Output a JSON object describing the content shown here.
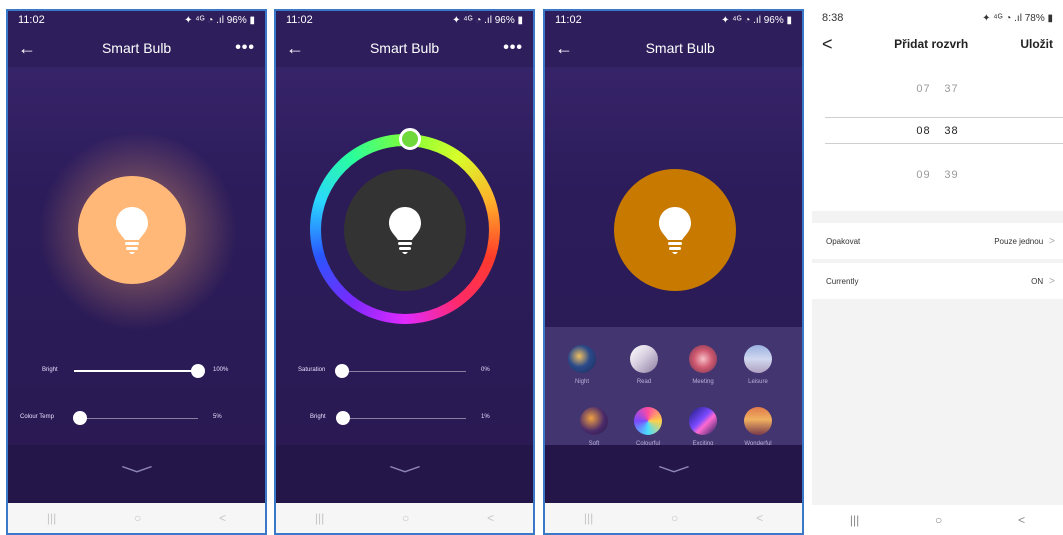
{
  "screen1": {
    "status_time": "11:02",
    "status_right": "✦ ⁴ᴳ ◔ .ıl 96% ▮",
    "title": "Smart Bulb",
    "back": "←",
    "more": "•••",
    "bright_label": "Bright",
    "bright_value": "100%",
    "bright_level": 1.0,
    "temp_label": "Colour Temp",
    "temp_value": "5%",
    "temp_level": 0.05,
    "bulb_color": "#FFB877"
  },
  "screen2": {
    "status_time": "11:02",
    "status_right": "✦ ⁴ᴳ ◔ .ıl 96% ▮",
    "title": "Smart Bulb",
    "back": "←",
    "more": "•••",
    "saturation_label": "Saturation",
    "saturation_value": "0%",
    "saturation_level": 0.0,
    "bright_label": "Bright",
    "bright_value": "1%",
    "bright_level": 0.01,
    "bulb_color": "#333333",
    "selected_color": "#6FD83A"
  },
  "screen3": {
    "status_time": "11:02",
    "status_right": "✦ ⁴ᴳ ◔ .ıl 96% ▮",
    "title": "Smart Bulb",
    "back": "←",
    "bulb_color": "#C87A00",
    "scenes": [
      "Night",
      "Read",
      "Meeting",
      "Leisure",
      "Soft",
      "Colourful",
      "Exciting",
      "Wonderful"
    ],
    "active_scene": "Night"
  },
  "screen4": {
    "status_time": "8:38",
    "status_right": "✦ ⁴ᴳ ◔ .ıl 78% ▮",
    "back": "<",
    "title": "Přidat rozvrh",
    "save": "Uložit",
    "time_rows": [
      {
        "h": "07",
        "m": "37"
      },
      {
        "h": "08",
        "m": "38"
      },
      {
        "h": "09",
        "m": "39"
      }
    ],
    "repeat_label": "Opakovat",
    "repeat_value": "Pouze jednou",
    "current_label": "Currently",
    "current_value": "ON"
  },
  "nav": {
    "recent": "|||",
    "home": "○",
    "back": "<"
  },
  "chevron": "﹀"
}
